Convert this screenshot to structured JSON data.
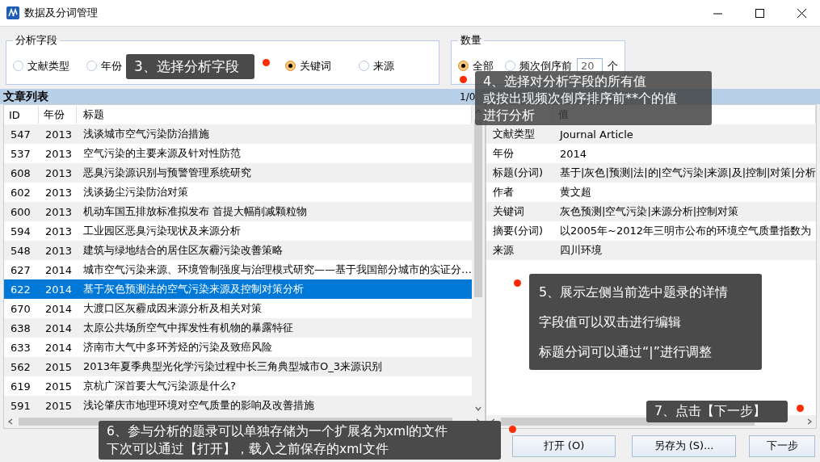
{
  "window": {
    "title": "数据及分词管理"
  },
  "analysis_field": {
    "legend": "分析字段",
    "options": [
      {
        "label": "文献类型",
        "selected": false
      },
      {
        "label": "年份",
        "selected": false
      },
      {
        "label": "关键词",
        "selected": true
      },
      {
        "label": "来源",
        "selected": false
      }
    ]
  },
  "quantity": {
    "legend": "数量",
    "options": [
      {
        "label": "全部",
        "selected": true
      },
      {
        "label": "频次倒序前",
        "selected": false
      }
    ],
    "count_field": {
      "value": "20"
    },
    "unit": "个"
  },
  "article_list": {
    "title": "文章列表",
    "columns": [
      "ID",
      "年份",
      "标题"
    ],
    "rows": [
      {
        "id": "547",
        "year": "2013",
        "title": "浅谈城市空气污染防治措施",
        "selected": false
      },
      {
        "id": "537",
        "year": "2013",
        "title": "空气污染的主要来源及针对性防范",
        "selected": false
      },
      {
        "id": "608",
        "year": "2013",
        "title": "恶臭污染源识别与预警管理系统研究",
        "selected": false
      },
      {
        "id": "602",
        "year": "2013",
        "title": "浅谈扬尘污染防治对策",
        "selected": false
      },
      {
        "id": "600",
        "year": "2013",
        "title": "机动车国五排放标准拟发布  首提大幅削减颗粒物",
        "selected": false
      },
      {
        "id": "594",
        "year": "2013",
        "title": "工业园区恶臭污染现状及来源分析",
        "selected": false
      },
      {
        "id": "548",
        "year": "2013",
        "title": "建筑与绿地结合的居住区灰霾污染改善策略",
        "selected": false
      },
      {
        "id": "627",
        "year": "2014",
        "title": "城市空气污染来源、环境管制强度与治理模式研究——基于我国部分城市的实证分…",
        "selected": false
      },
      {
        "id": "622",
        "year": "2014",
        "title": "基于灰色预测法的空气污染来源及控制对策分析",
        "selected": true
      },
      {
        "id": "670",
        "year": "2014",
        "title": "大渡口区灰霾成因来源分析及相关对策",
        "selected": false
      },
      {
        "id": "638",
        "year": "2014",
        "title": "太原公共场所空气中挥发性有机物的暴露特征",
        "selected": false
      },
      {
        "id": "633",
        "year": "2014",
        "title": "济南市大气中多环芳烃的污染及致癌风险",
        "selected": false
      },
      {
        "id": "562",
        "year": "2015",
        "title": "2013年夏季典型光化学污染过程中长三角典型城市O_3来源识别",
        "selected": false
      },
      {
        "id": "619",
        "year": "2015",
        "title": "京杭广深首要大气污染源是什么?",
        "selected": false
      },
      {
        "id": "591",
        "year": "2015",
        "title": "浅论肇庆市地理环境对空气质量的影响及改善措施",
        "selected": false
      }
    ]
  },
  "detail": {
    "counter": "1/0",
    "columns": [
      "值"
    ],
    "rows": [
      {
        "field": "文献类型",
        "value": "Journal Article"
      },
      {
        "field": "年份",
        "value": "2014"
      },
      {
        "field": "标题(分词)",
        "value": "基于|灰色|预测|法|的|空气污染|来源|及|控制|对策|分析"
      },
      {
        "field": "作者",
        "value": "黄文超"
      },
      {
        "field": "关键词",
        "value": "灰色预测|空气污染|来源分析|控制对策"
      },
      {
        "field": "摘要(分词)",
        "value": "以2005年~2012年三明市公布的环境空气质量指数为"
      },
      {
        "field": "来源",
        "value": "四川环境"
      }
    ]
  },
  "buttons": [
    {
      "label": "打开 (O)"
    },
    {
      "label": "另存为 (S)..."
    },
    {
      "label": "下一步"
    }
  ],
  "callouts": [
    {
      "lines": [
        "3、选择分析字段"
      ]
    },
    {
      "lines": [
        "4、选择对分析字段的所有值",
        "或按出现频次倒序排序前**个的值",
        "进行分析"
      ]
    },
    {
      "lines": [
        "5、展示左侧当前选中题录的详情",
        "字段值可以双击进行编辑",
        "标题分词可以通过“|”进行调整"
      ]
    },
    {
      "lines": [
        "6、参与分析的题录可以单独存储为一个扩展名为xml的文件",
        "下次可以通过【打开】，载入之前保存的xml文件"
      ]
    },
    {
      "lines": [
        "7、点击【下一步】"
      ]
    }
  ]
}
